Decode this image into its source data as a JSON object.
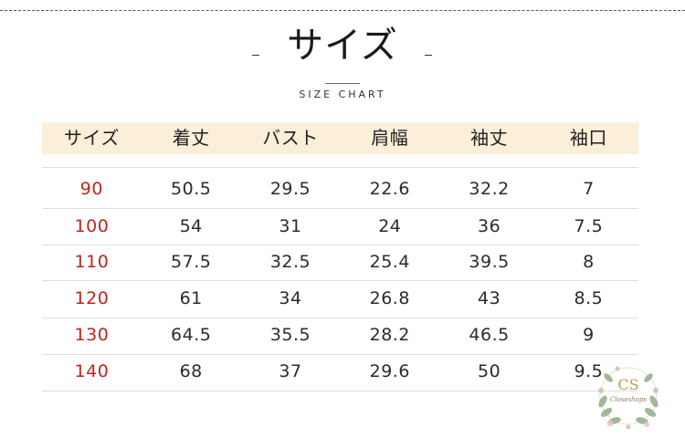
{
  "title": "サイズ",
  "subtitle": "SIZE CHART",
  "table": {
    "headers": [
      "サイズ",
      "着丈",
      "バスト",
      "肩幅",
      "袖丈",
      "袖口"
    ],
    "rows": [
      [
        "90",
        "50.5",
        "29.5",
        "22.6",
        "32.2",
        "7"
      ],
      [
        "100",
        "54",
        "31",
        "24",
        "36",
        "7.5"
      ],
      [
        "110",
        "57.5",
        "32.5",
        "25.4",
        "39.5",
        "8"
      ],
      [
        "120",
        "61",
        "34",
        "26.8",
        "43",
        "8.5"
      ],
      [
        "130",
        "64.5",
        "35.5",
        "28.2",
        "46.5",
        "9"
      ],
      [
        "140",
        "68",
        "37",
        "29.6",
        "50",
        "9.5"
      ]
    ]
  },
  "logo": {
    "monogram": "CS",
    "name": "Closeshops"
  },
  "colors": {
    "header_band": "#fcefd9",
    "size_text": "#c2241c",
    "rule": "#dedede"
  }
}
